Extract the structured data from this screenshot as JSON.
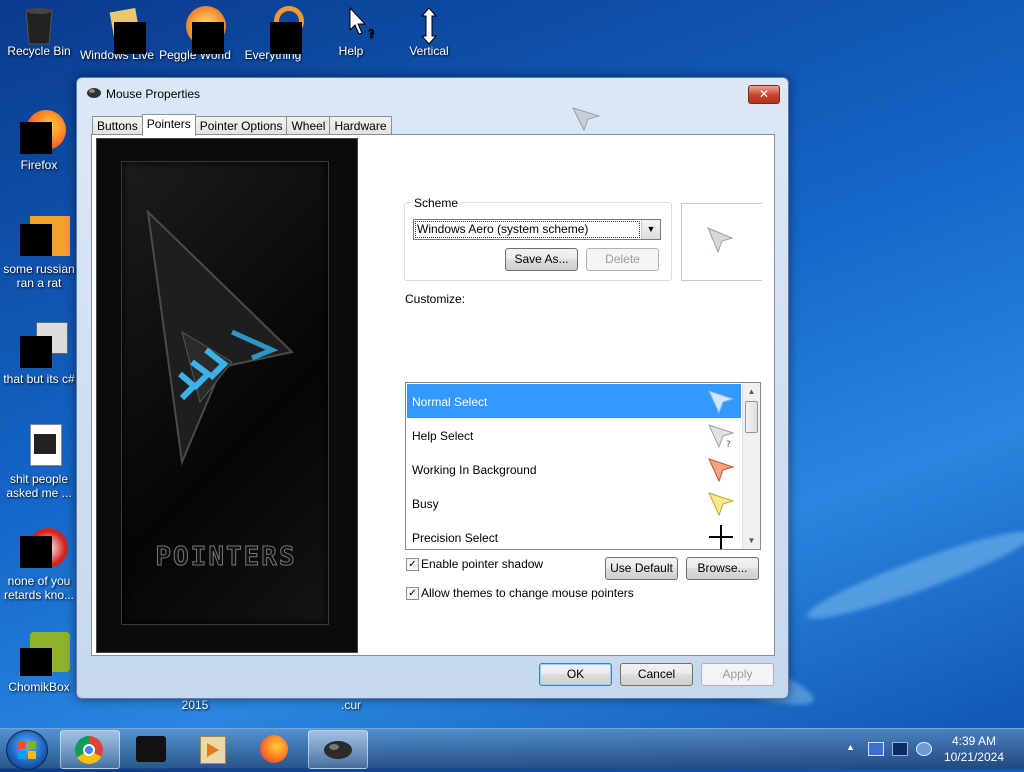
{
  "desktop": {
    "icons": [
      {
        "label": "Recycle Bin",
        "icon": "recycle-bin-icon"
      },
      {
        "label": "Windows Live",
        "icon": "windows-live-icon"
      },
      {
        "label": "Peggle World",
        "icon": "peggle-icon"
      },
      {
        "label": "Everything",
        "icon": "everything-icon"
      },
      {
        "label": "Help",
        "icon": "help-cursor-icon"
      },
      {
        "label": "Vertical",
        "icon": "vertical-resize-icon"
      },
      {
        "label": "Firefox",
        "icon": "firefox-icon"
      },
      {
        "label": "some russian ran a rat",
        "icon": "app-icon"
      },
      {
        "label": "that but its c#",
        "icon": "app-icon"
      },
      {
        "label": "shit people asked me ...",
        "icon": "file-icon"
      },
      {
        "label": "none of you retards kno...",
        "icon": "app-icon"
      },
      {
        "label": "ChomikBox",
        "icon": "chomikbox-icon"
      }
    ],
    "partial_labels": [
      "2015",
      ".cur"
    ]
  },
  "window": {
    "title": "Mouse Properties",
    "close_label": "✕",
    "tabs": [
      "Buttons",
      "Pointers",
      "Pointer Options",
      "Wheel",
      "Hardware"
    ],
    "active_tab": "Pointers",
    "preview_brand": "POINTERS",
    "scheme": {
      "legend": "Scheme",
      "selected": "Windows Aero (system scheme)",
      "save_as": "Save As...",
      "delete": "Delete"
    },
    "customize_label": "Customize:",
    "pointers": [
      {
        "label": "Normal Select",
        "selected": true,
        "cursor": "arrow-cursor-icon"
      },
      {
        "label": "Help Select",
        "selected": false,
        "cursor": "help-cursor-icon"
      },
      {
        "label": "Working In Background",
        "selected": false,
        "cursor": "working-cursor-icon"
      },
      {
        "label": "Busy",
        "selected": false,
        "cursor": "busy-cursor-icon"
      },
      {
        "label": "Precision Select",
        "selected": false,
        "cursor": "crosshair-icon"
      }
    ],
    "enable_shadow": {
      "label": "Enable pointer shadow",
      "checked": true
    },
    "allow_themes": {
      "label": "Allow themes to change mouse pointers",
      "checked": true
    },
    "use_default": "Use Default",
    "browse": "Browse...",
    "ok": "OK",
    "cancel": "Cancel",
    "apply": "Apply"
  },
  "taskbar": {
    "time": "4:39 AM",
    "date": "10/21/2024"
  }
}
